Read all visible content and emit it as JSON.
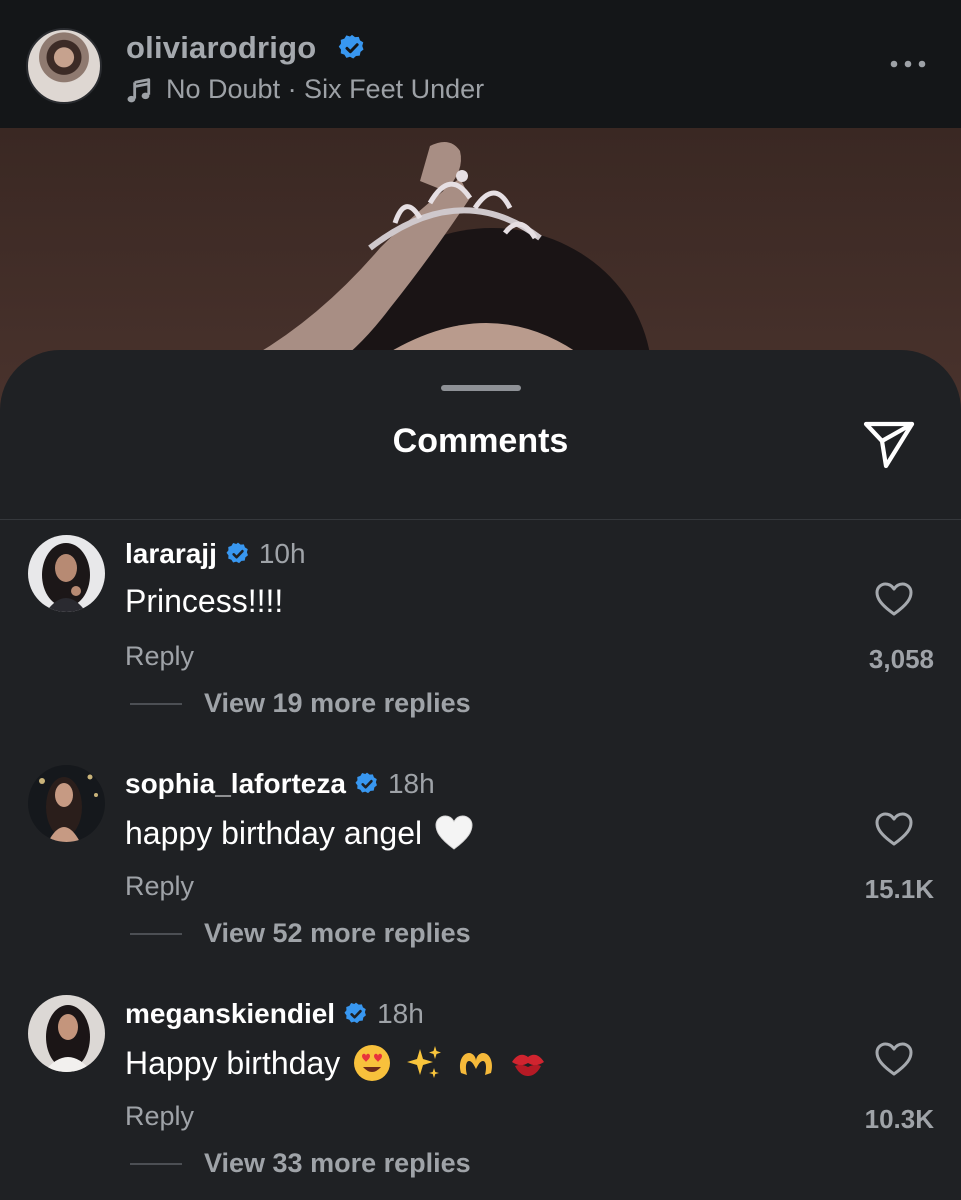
{
  "header": {
    "username": "oliviarodrigo",
    "music": "No Doubt · Six Feet Under"
  },
  "sheet": {
    "title": "Comments"
  },
  "comments": [
    {
      "user": "lararajj",
      "time": "10h",
      "text": "Princess!!!!",
      "reply_label": "Reply",
      "likes": "3,058",
      "view_replies": "View 19 more replies"
    },
    {
      "user": "sophia_laforteza",
      "time": "18h",
      "text": "happy birthday angel",
      "emojis": [
        "white-heart"
      ],
      "reply_label": "Reply",
      "likes": "15.1K",
      "view_replies": "View 52 more replies"
    },
    {
      "user": "meganskiendiel",
      "time": "18h",
      "text": "Happy birthday",
      "emojis": [
        "heart-eyes",
        "sparkles",
        "heart-hands",
        "kiss-mark"
      ],
      "reply_label": "Reply",
      "likes": "10.3K",
      "view_replies": "View 33 more replies"
    }
  ],
  "colors": {
    "background": "#1f2124",
    "header_bg": "#141618",
    "verified": "#3897f0",
    "muted_text": "#9fa3a8"
  }
}
